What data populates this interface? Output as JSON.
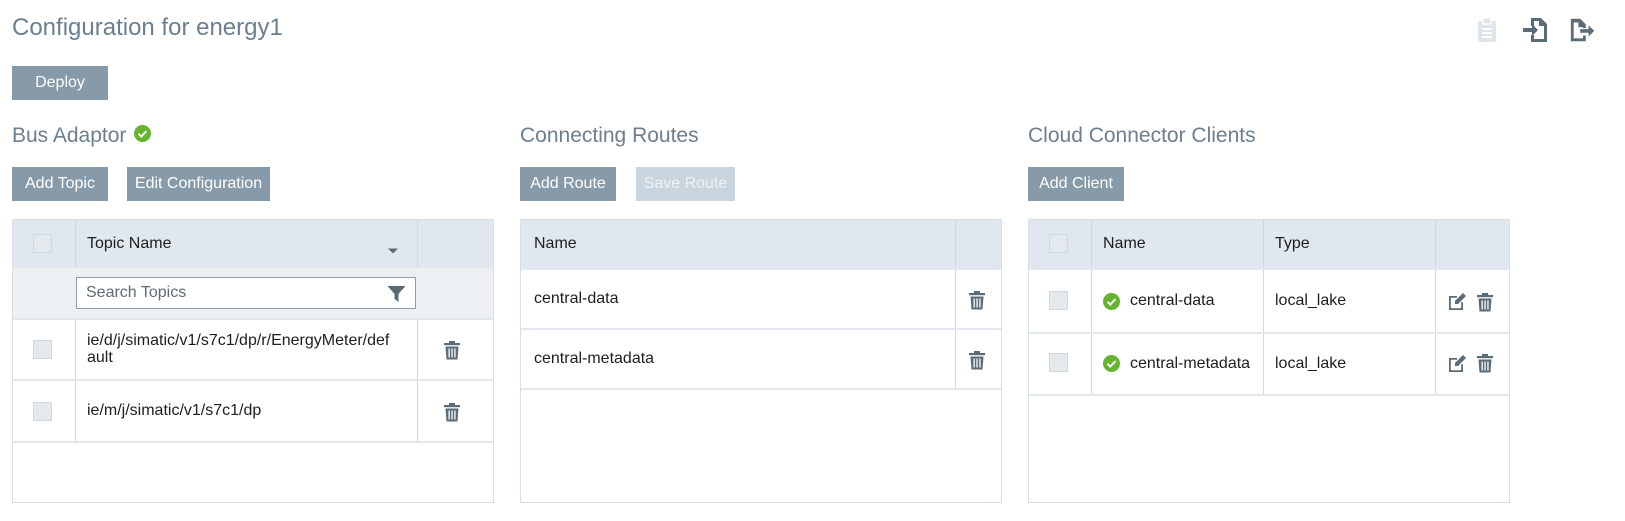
{
  "header": {
    "title": "Configuration for energy1",
    "icons": [
      "clipboard-icon",
      "import-icon",
      "export-icon"
    ]
  },
  "toolbar": {
    "deploy_label": "Deploy"
  },
  "bus_adaptor": {
    "title": "Bus Adaptor",
    "status": "ok",
    "add_topic_label": "Add Topic",
    "edit_config_label": "Edit Configuration",
    "columns": {
      "name": "Topic Name"
    },
    "search_placeholder": "Search Topics",
    "rows": [
      {
        "name_line1": "ie/d/j/simatic/v1/s7c1/dp/r/EnergyMeter/def",
        "name_line2": "ault"
      },
      {
        "name_line1": "ie/m/j/simatic/v1/s7c1/dp",
        "name_line2": ""
      }
    ]
  },
  "connecting_routes": {
    "title": "Connecting Routes",
    "add_route_label": "Add Route",
    "save_route_label": "Save Route",
    "columns": {
      "name": "Name"
    },
    "rows": [
      {
        "name": "central-data"
      },
      {
        "name": "central-metadata"
      }
    ]
  },
  "cloud_clients": {
    "title": "Cloud Connector Clients",
    "add_client_label": "Add Client",
    "columns": {
      "name": "Name",
      "type": "Type"
    },
    "rows": [
      {
        "name": "central-data",
        "type": "local_lake",
        "status": "ok"
      },
      {
        "name": "central-metadata",
        "type": "local_lake",
        "status": "ok"
      }
    ]
  },
  "colors": {
    "accent": "#879aa9",
    "title": "#6c7f8e",
    "success": "#65b32e",
    "header_bg": "#e1e7ee"
  }
}
